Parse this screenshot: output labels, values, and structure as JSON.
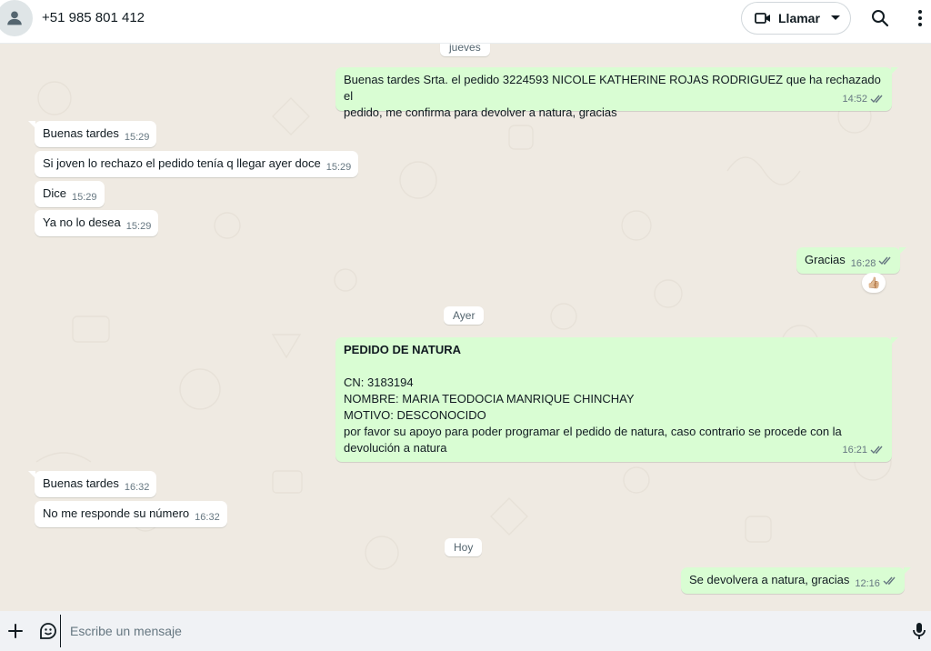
{
  "header": {
    "contact": "+51 985 801 412",
    "call_label": "Llamar"
  },
  "chat": {
    "dates": {
      "jueves": "jueves",
      "ayer": "Ayer",
      "hoy": "Hoy"
    },
    "messages": [
      {
        "dir": "out",
        "lines": [
          "Buenas tardes Srta. el pedido 3224593 NICOLE KATHERINE ROJAS RODRIGUEZ que ha rechazado el",
          "pedido, me confirma para devolver a natura, gracias"
        ],
        "time": "14:52"
      },
      {
        "dir": "in",
        "text": "Buenas tardes",
        "time": "15:29"
      },
      {
        "dir": "in",
        "text": "Si joven lo rechazo el pedido tenía q llegar ayer doce",
        "time": "15:29"
      },
      {
        "dir": "in",
        "text": "Dice",
        "time": "15:29"
      },
      {
        "dir": "in",
        "text": "Ya no lo desea",
        "time": "15:29"
      },
      {
        "dir": "out",
        "text": "Gracias",
        "time": "16:28",
        "reaction": "👍🏼"
      },
      {
        "dir": "out",
        "title": "PEDIDO DE NATURA",
        "lines": [
          "CN: 3183194",
          "NOMBRE:  MARIA TEODOCIA MANRIQUE CHINCHAY",
          "MOTIVO: DESCONOCIDO",
          "por favor  su apoyo para poder programar el pedido de natura, caso contrario se procede con la",
          "devolución a natura"
        ],
        "time": "16:21"
      },
      {
        "dir": "in",
        "text": "Buenas tardes",
        "time": "16:32"
      },
      {
        "dir": "in",
        "text": "No me responde su número",
        "time": "16:32"
      },
      {
        "dir": "out",
        "text": "Se devolvera a natura, gracias",
        "time": "12:16"
      }
    ]
  },
  "composer": {
    "placeholder": "Escribe un mensaje"
  },
  "colors": {
    "outgoing_bubble": "#d9fdd3",
    "incoming_bubble": "#ffffff",
    "chat_background": "#efeae2",
    "read_ticks": "#53bdeb"
  },
  "icons": [
    "user-avatar-icon",
    "video-camera-icon",
    "caret-down-icon",
    "search-icon",
    "kebab-menu-icon",
    "plus-icon",
    "sticker-icon",
    "microphone-icon",
    "double-check-icon"
  ]
}
